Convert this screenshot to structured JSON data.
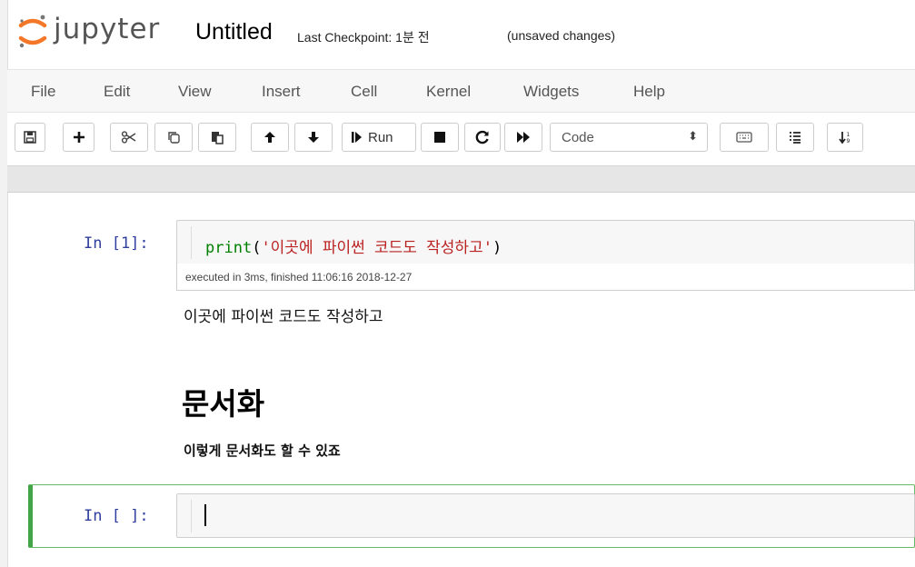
{
  "header": {
    "logo_text": "jupyter",
    "notebook_title": "Untitled",
    "checkpoint": "Last Checkpoint: 1분 전",
    "unsaved": "(unsaved changes)"
  },
  "menu": [
    "File",
    "Edit",
    "View",
    "Insert",
    "Cell",
    "Kernel",
    "Widgets",
    "Help"
  ],
  "toolbar": {
    "run_label": "Run",
    "cell_type": "Code",
    "icons": [
      "save-icon",
      "plus-icon",
      "cut-icon",
      "copy-icon",
      "paste-icon",
      "arrow-up-icon",
      "arrow-down-icon",
      "run-icon",
      "stop-icon",
      "restart-icon",
      "fast-forward-icon",
      "keyboard-icon",
      "list-icon",
      "sort-icon"
    ]
  },
  "cells": {
    "code1": {
      "prompt": "In [1]:",
      "code_func": "print",
      "code_open": "(",
      "code_string": "'이곳에 파이썬 코드도 작성하고'",
      "code_close": ")",
      "exec_info": "executed in 3ms, finished 11:06:16 2018-12-27",
      "output": "이곳에 파이썬 코드도 작성하고"
    },
    "markdown": {
      "heading": "문서화",
      "paragraph": "이렇게 문서화도 할 수 있죠"
    },
    "code2": {
      "prompt": "In [ ]:"
    }
  },
  "colors": {
    "prompt": "#303f9f",
    "keyword": "#008000",
    "string": "#ba2121",
    "selected_border": "#42a548",
    "logo_orange": "#f37726"
  }
}
